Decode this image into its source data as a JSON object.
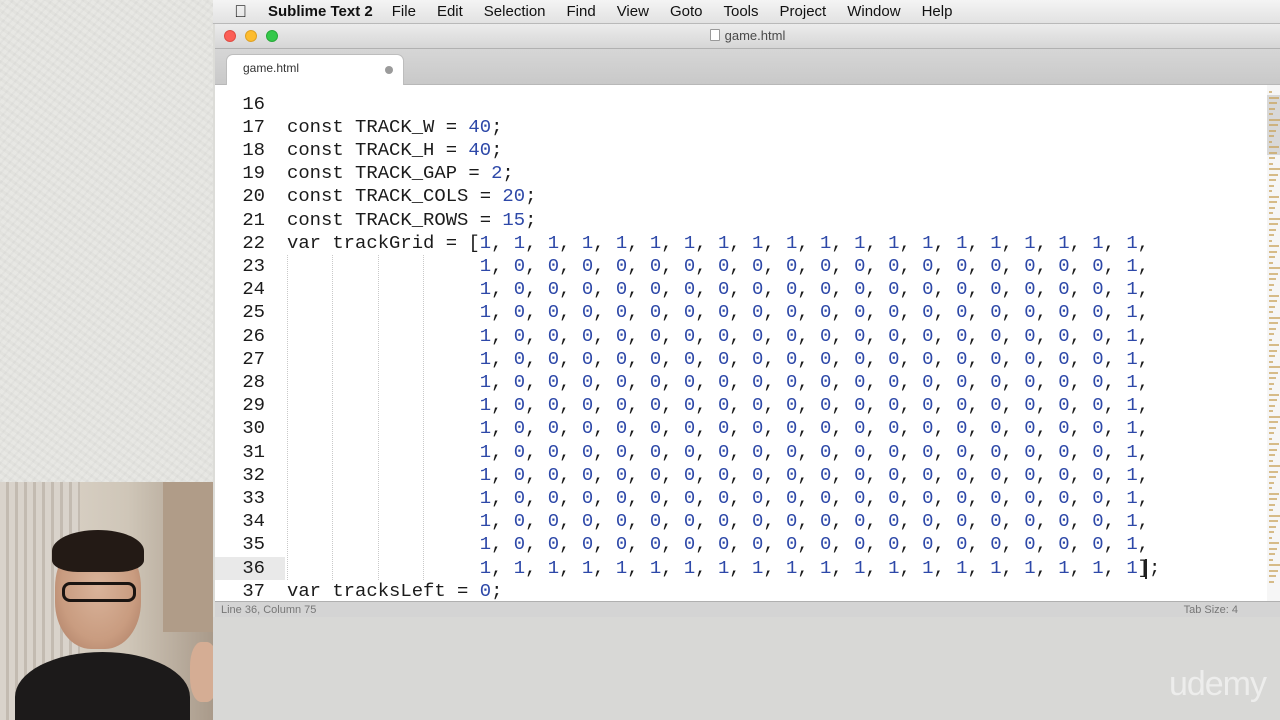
{
  "menubar": {
    "app_name": "Sublime Text 2",
    "items": [
      "File",
      "Edit",
      "Selection",
      "Find",
      "View",
      "Goto",
      "Tools",
      "Project",
      "Window",
      "Help"
    ]
  },
  "window": {
    "title": "game.html"
  },
  "tabs": [
    {
      "label": "game.html",
      "dirty": true
    }
  ],
  "editor": {
    "first_line": 16,
    "current_line": 36,
    "lines": [
      {
        "n": "16",
        "t": ""
      },
      {
        "n": "17",
        "t": "const TRACK_W = 40;"
      },
      {
        "n": "18",
        "t": "const TRACK_H = 40;"
      },
      {
        "n": "19",
        "t": "const TRACK_GAP = 2;"
      },
      {
        "n": "20",
        "t": "const TRACK_COLS = 20;"
      },
      {
        "n": "21",
        "t": "const TRACK_ROWS = 15;"
      },
      {
        "n": "22",
        "t": "var trackGrid = [1, 1, 1, 1, 1, 1, 1, 1, 1, 1, 1, 1, 1, 1, 1, 1, 1, 1, 1, 1,"
      },
      {
        "n": "23",
        "t": "                 1, 0, 0, 0, 0, 0, 0, 0, 0, 0, 0, 0, 0, 0, 0, 0, 0, 0, 0, 1,"
      },
      {
        "n": "24",
        "t": "                 1, 0, 0, 0, 0, 0, 0, 0, 0, 0, 0, 0, 0, 0, 0, 0, 0, 0, 0, 1,"
      },
      {
        "n": "25",
        "t": "                 1, 0, 0, 0, 0, 0, 0, 0, 0, 0, 0, 0, 0, 0, 0, 0, 0, 0, 0, 1,"
      },
      {
        "n": "26",
        "t": "                 1, 0, 0, 0, 0, 0, 0, 0, 0, 0, 0, 0, 0, 0, 0, 0, 0, 0, 0, 1,"
      },
      {
        "n": "27",
        "t": "                 1, 0, 0, 0, 0, 0, 0, 0, 0, 0, 0, 0, 0, 0, 0, 0, 0, 0, 0, 1,"
      },
      {
        "n": "28",
        "t": "                 1, 0, 0, 0, 0, 0, 0, 0, 0, 0, 0, 0, 0, 0, 0, 0, 0, 0, 0, 1,"
      },
      {
        "n": "29",
        "t": "                 1, 0, 0, 0, 0, 0, 0, 0, 0, 0, 0, 0, 0, 0, 0, 0, 0, 0, 0, 1,"
      },
      {
        "n": "30",
        "t": "                 1, 0, 0, 0, 0, 0, 0, 0, 0, 0, 0, 0, 0, 0, 0, 0, 0, 0, 0, 1,"
      },
      {
        "n": "31",
        "t": "                 1, 0, 0, 0, 0, 0, 0, 0, 0, 0, 0, 0, 0, 0, 0, 0, 0, 0, 0, 1,"
      },
      {
        "n": "32",
        "t": "                 1, 0, 0, 0, 0, 0, 0, 0, 0, 0, 0, 0, 0, 0, 0, 0, 0, 0, 0, 1,"
      },
      {
        "n": "33",
        "t": "                 1, 0, 0, 0, 0, 0, 0, 0, 0, 0, 0, 0, 0, 0, 0, 0, 0, 0, 0, 1,"
      },
      {
        "n": "34",
        "t": "                 1, 0, 0, 0, 0, 0, 0, 0, 0, 0, 0, 0, 0, 0, 0, 0, 0, 0, 0, 1,"
      },
      {
        "n": "35",
        "t": "                 1, 0, 0, 0, 0, 0, 0, 0, 0, 0, 0, 0, 0, 0, 0, 0, 0, 0, 0, 1,"
      },
      {
        "n": "36",
        "t": "                 1, 1, 1, 1, 1, 1, 1, 1, 1, 1, 1, 1, 1, 1, 1, 1, 1, 1, 1, 1];"
      },
      {
        "n": "37",
        "t": "var tracksLeft = 0;"
      }
    ]
  },
  "statusbar": {
    "position": "Line 36, Column 75",
    "tab_size": "Tab Size: 4"
  },
  "watermark": "udemy",
  "colors": {
    "number": "#2d48a8",
    "text": "#1b1b1b",
    "close": "#fc5f57",
    "minimize": "#fdbc2e",
    "zoom": "#34c84a"
  }
}
